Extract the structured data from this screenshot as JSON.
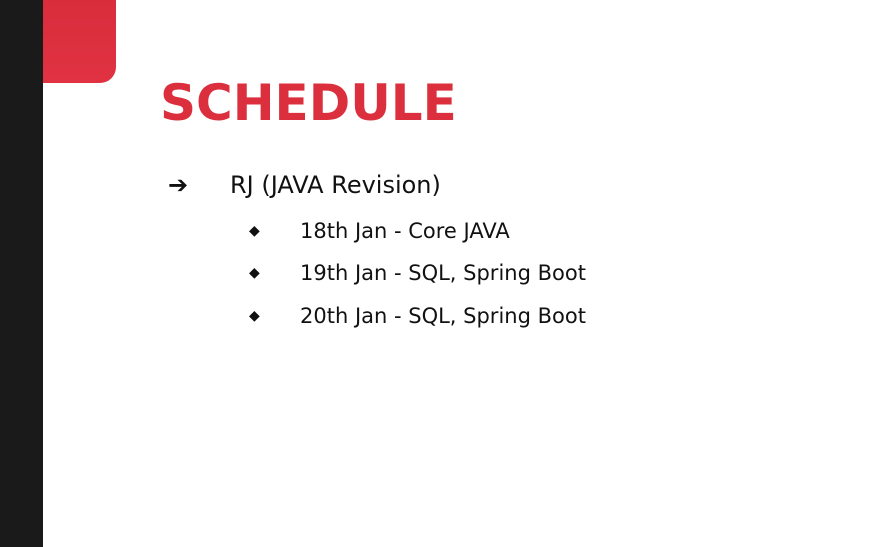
{
  "slide": {
    "title": "SCHEDULE",
    "main_item": {
      "bullet": "➔",
      "label": "RJ (JAVA Revision)"
    },
    "sub_items": [
      {
        "bullet": "◆",
        "label": "18th Jan - Core JAVA"
      },
      {
        "bullet": "◆",
        "label": "19th Jan - SQL, Spring Boot"
      },
      {
        "bullet": "◆",
        "label": "20th Jan - SQL, Spring Boot"
      }
    ]
  },
  "colors": {
    "accent": "#dc2f3e",
    "sidebar": "#1a1a1a",
    "text": "#111111",
    "background": "#ffffff"
  }
}
